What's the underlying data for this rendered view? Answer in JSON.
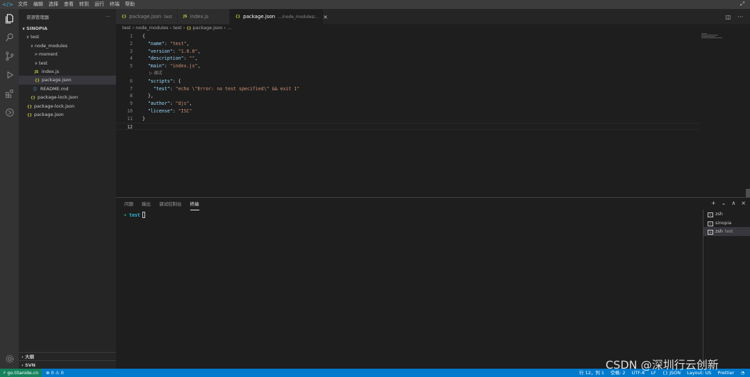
{
  "titlebar": {
    "menu": [
      "文件",
      "编辑",
      "选择",
      "查看",
      "转到",
      "运行",
      "终端",
      "帮助"
    ]
  },
  "sidebar": {
    "title": "资源管理器",
    "more": "···",
    "tree": [
      {
        "label": "SINOPIA",
        "twisty": "∨",
        "type": "root"
      },
      {
        "label": "test",
        "twisty": "∨",
        "type": "folder"
      },
      {
        "label": "node_modules",
        "twisty": "∨",
        "type": "folder"
      },
      {
        "label": "moment",
        "twisty": ">",
        "type": "folder"
      },
      {
        "label": "test",
        "twisty": "∨",
        "type": "folder"
      },
      {
        "label": "index.js",
        "type": "js"
      },
      {
        "label": "package.json",
        "type": "json",
        "selected": true
      },
      {
        "label": "README.md",
        "type": "md"
      },
      {
        "label": "package-lock.json",
        "type": "json"
      },
      {
        "label": "package-lock.json",
        "type": "json"
      },
      {
        "label": "package.json",
        "type": "json"
      }
    ],
    "outline": "大纲",
    "svn": "SVN"
  },
  "tabs": [
    {
      "icon": "{}",
      "label": "package.json",
      "desc": "test",
      "active": false
    },
    {
      "icon": "JS",
      "label": "index.js",
      "desc": "",
      "active": false
    },
    {
      "icon": "{}",
      "label": "package.json",
      "desc": ".../node_modules/...",
      "active": true,
      "close": "×"
    }
  ],
  "breadcrumb": {
    "a": "test",
    "b": "node_modules",
    "c": "test",
    "d": "package.json",
    "e": "..."
  },
  "editor": {
    "lines": [
      {
        "n": "1",
        "code": [
          {
            "t": "{",
            "c": "p"
          }
        ]
      },
      {
        "n": "2",
        "code": [
          {
            "t": "  ",
            "c": "p"
          },
          {
            "t": "\"name\"",
            "c": "k"
          },
          {
            "t": ": ",
            "c": "p"
          },
          {
            "t": "\"test\"",
            "c": "s"
          },
          {
            "t": ",",
            "c": "p"
          }
        ]
      },
      {
        "n": "3",
        "code": [
          {
            "t": "  ",
            "c": "p"
          },
          {
            "t": "\"version\"",
            "c": "k"
          },
          {
            "t": ": ",
            "c": "p"
          },
          {
            "t": "\"1.0.0\"",
            "c": "s"
          },
          {
            "t": ",",
            "c": "p"
          }
        ]
      },
      {
        "n": "4",
        "code": [
          {
            "t": "  ",
            "c": "p"
          },
          {
            "t": "\"description\"",
            "c": "k"
          },
          {
            "t": ": ",
            "c": "p"
          },
          {
            "t": "\"\"",
            "c": "s"
          },
          {
            "t": ",",
            "c": "p"
          }
        ]
      },
      {
        "n": "5",
        "code": [
          {
            "t": "  ",
            "c": "p"
          },
          {
            "t": "\"main\"",
            "c": "k"
          },
          {
            "t": ": ",
            "c": "p"
          },
          {
            "t": "\"index.js\"",
            "c": "s"
          },
          {
            "t": ",",
            "c": "p"
          }
        ]
      },
      {
        "n": "6",
        "code": [
          {
            "t": "  ",
            "c": "p"
          },
          {
            "t": "\"scripts\"",
            "c": "k"
          },
          {
            "t": ": {",
            "c": "p"
          }
        ]
      },
      {
        "n": "7",
        "code": [
          {
            "t": "    ",
            "c": "p"
          },
          {
            "t": "\"test\"",
            "c": "k"
          },
          {
            "t": ": ",
            "c": "p"
          },
          {
            "t": "\"echo \\\"Error: no test specified\\\" && exit 1\"",
            "c": "s"
          }
        ]
      },
      {
        "n": "8",
        "code": [
          {
            "t": "  },",
            "c": "p"
          }
        ]
      },
      {
        "n": "9",
        "code": [
          {
            "t": "  ",
            "c": "p"
          },
          {
            "t": "\"author\"",
            "c": "k"
          },
          {
            "t": ": ",
            "c": "p"
          },
          {
            "t": "\"djs\"",
            "c": "s"
          },
          {
            "t": ",",
            "c": "p"
          }
        ]
      },
      {
        "n": "10",
        "code": [
          {
            "t": "  ",
            "c": "p"
          },
          {
            "t": "\"license\"",
            "c": "k"
          },
          {
            "t": ": ",
            "c": "p"
          },
          {
            "t": "\"ISC\"",
            "c": "s"
          }
        ]
      },
      {
        "n": "11",
        "code": [
          {
            "t": "}",
            "c": "p"
          }
        ]
      },
      {
        "n": "12",
        "code": [],
        "current": true
      }
    ],
    "codelens": "▷ 调试"
  },
  "panel": {
    "tabs": [
      "问题",
      "输出",
      "调试控制台",
      "终端"
    ],
    "active_tab": "终端",
    "actions": [
      "+",
      "⌄",
      "∧",
      "×"
    ],
    "terminal": {
      "arrow": "➜",
      "dir": "test"
    },
    "terminals": [
      {
        "label": "zsh",
        "desc": ""
      },
      {
        "label": "sinopia",
        "desc": ""
      },
      {
        "label": "zsh",
        "desc": "test",
        "selected": true
      }
    ]
  },
  "statusbar": {
    "remote": "go.titanide.cn",
    "problems": "⊗ 0 ⚠ 0",
    "position": "行 12，列 1",
    "spaces": "空格: 2",
    "encoding": "UTF-8",
    "eol": "LF",
    "language": "{} JSON",
    "layout": "Layout: US",
    "formatter": "Prettier",
    "bell": "🔔"
  },
  "watermark": "CSDN @深圳行云创新",
  "colors": {
    "statusbar": "#007acc",
    "remote": "#16825d",
    "json_icon": "#cbcb41",
    "terminal_arrow": "#23d18b"
  }
}
